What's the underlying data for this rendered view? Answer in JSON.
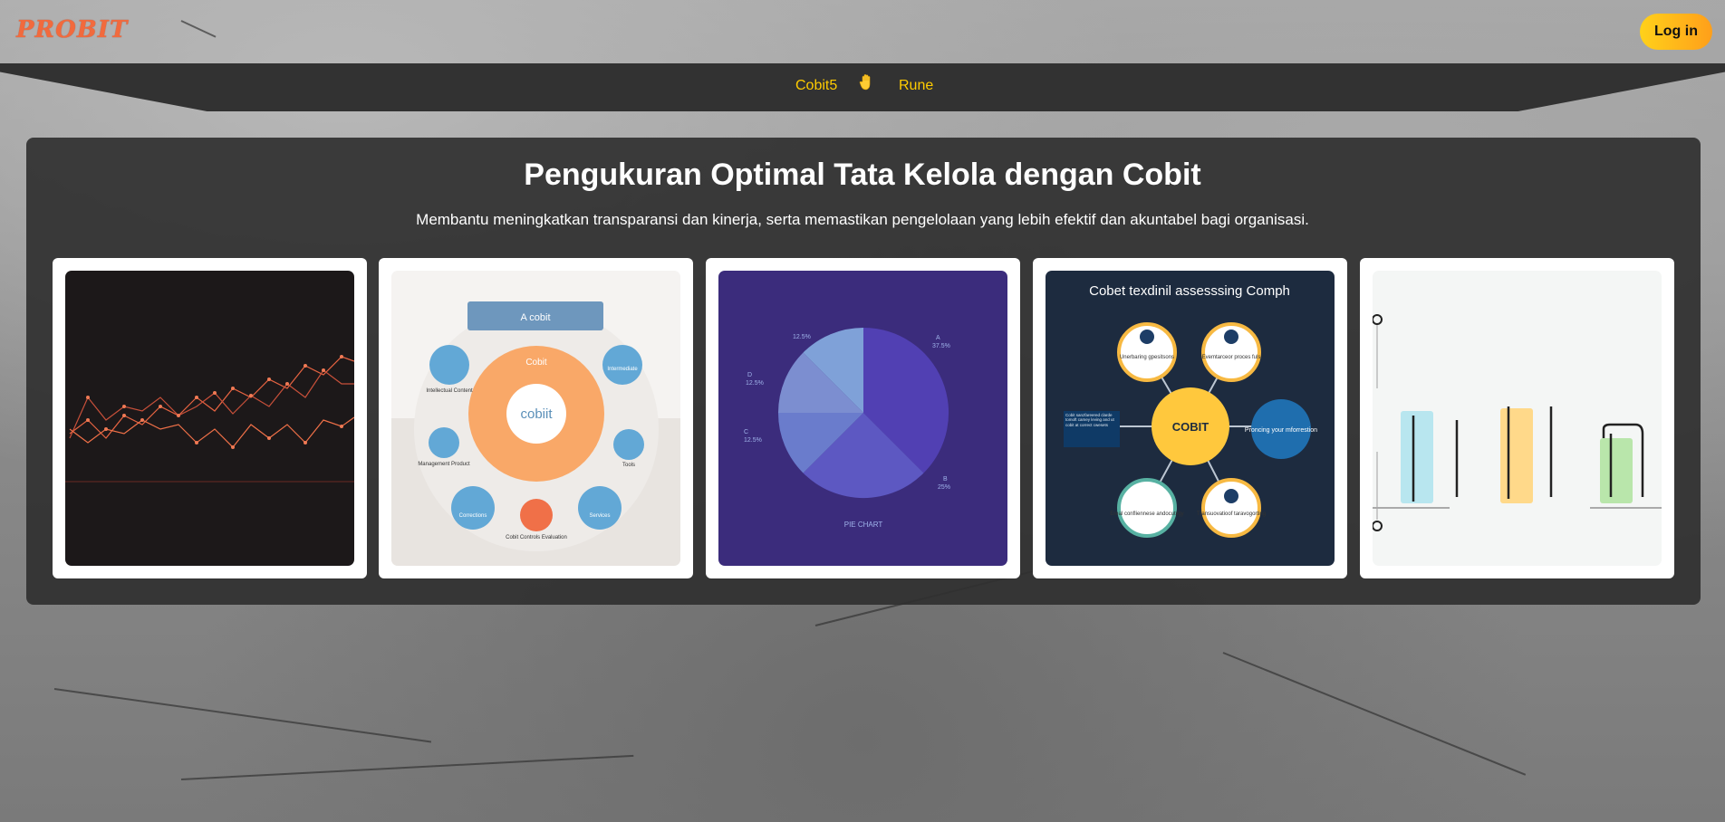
{
  "brand": {
    "logo_text": "PROBIT"
  },
  "header": {
    "login_label": "Log in"
  },
  "nav": {
    "items": [
      {
        "label": "Cobit5"
      },
      {
        "label": "Rune"
      }
    ],
    "hand_icon": "waving-hand-icon"
  },
  "hero": {
    "title": "Pengukuran Optimal Tata Kelola dengan Cobit",
    "subtitle": "Membantu meningkatkan transparansi dan kinerja, serta memastikan pengelolaan yang lebih efektif dan akuntabel bagi organisasi."
  },
  "colors": {
    "accent_orange": "#f26a3d",
    "login_gradient_start": "#ffd11a",
    "login_gradient_end": "#ff9f1a",
    "nav_link": "#ffcc00",
    "navbar_bg": "#323232",
    "hero_bg": "#303030"
  },
  "cards": [
    {
      "image": "line-chart-dark"
    },
    {
      "image": "cobit-diagram",
      "top_label": "A cobit",
      "center_ring_label": "Cobit",
      "center_label": "cobiit",
      "nodes": [
        "Intellectual Content",
        "Intermediate",
        "Management Product",
        "Tools",
        "Corrections",
        "Cobit Controls Evaluation",
        "Services"
      ]
    },
    {
      "image": "pie-chart",
      "caption": "PIE CHART",
      "slice_labels": [
        {
          "name": "A",
          "pct": "37.5%"
        },
        {
          "name": "B",
          "pct": "25%"
        },
        {
          "name": "C",
          "pct": "12.5%"
        },
        {
          "name": "D",
          "pct": "12.5%"
        },
        {
          "name": "",
          "pct": "12.5%"
        }
      ]
    },
    {
      "image": "cobit-hub-diagram",
      "title": "Cobet texdinil assesssing Comph",
      "center_label": "COBIT",
      "nodes": [
        "Unerbaring gpesitsons",
        "Evemtarceor proces fuls",
        "Proncing your mforrestion",
        "Transuovatioof taravogorting",
        "Ereal confliennese andocutilgy"
      ],
      "side_box": "Cobit sanzfareered clarde tomoft camey leving and ut cobit at correct cwesets"
    },
    {
      "image": "bar-illustration"
    }
  ]
}
